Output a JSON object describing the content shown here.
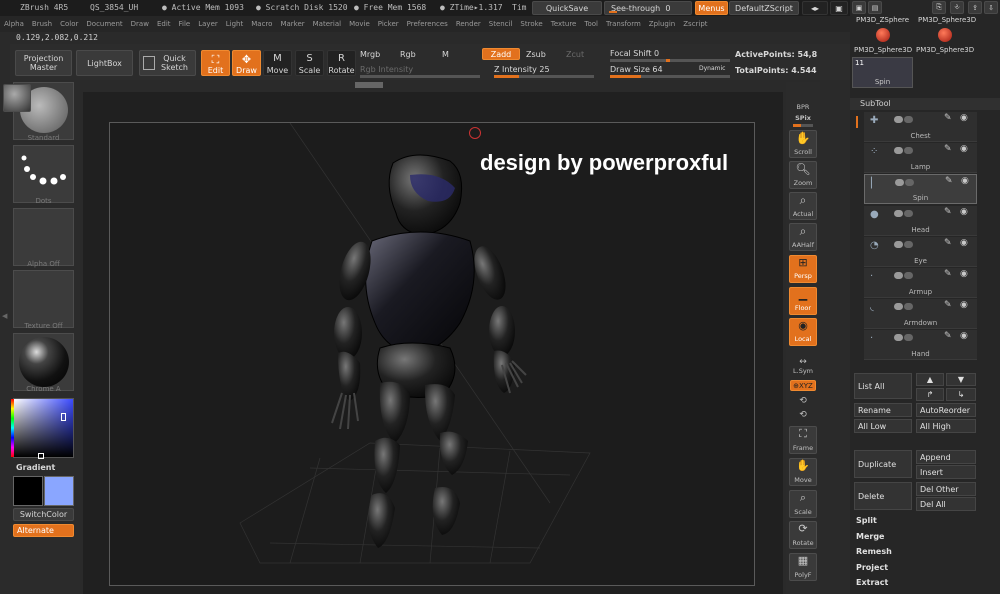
{
  "topbar": {
    "app": "ZBrush 4R5",
    "build": "QS_3854_UH",
    "active_mem": "● Active Mem 1093",
    "scratch": "● Scratch Disk 1520",
    "free_mem": "● Free Mem 1568",
    "ztime": "● ZTime▸1.317",
    "tim": "Tim",
    "quicksave": "QuickSave",
    "see_through": "See-through",
    "see_through_value": "0",
    "menus": "Menus",
    "default_zscript": "DefaultZScript"
  },
  "menubar": [
    "Alpha",
    "Brush",
    "Color",
    "Document",
    "Draw",
    "Edit",
    "File",
    "Layer",
    "Light",
    "Macro",
    "Marker",
    "Material",
    "Movie",
    "Picker",
    "Preferences",
    "Render",
    "Stencil",
    "Stroke",
    "Texture",
    "Tool",
    "Transform",
    "Zplugin",
    "Zscript"
  ],
  "coords": "0.129,2.082,0.212",
  "shelf": {
    "projection_master": "Projection Master",
    "lightbox": "LightBox",
    "quick_sketch": "Quick Sketch",
    "edit": "Edit",
    "draw": "Draw",
    "move": "Move",
    "scale": "Scale",
    "rotate": "Rotate",
    "mrgb": "Mrgb",
    "rgb": "Rgb",
    "m": "M",
    "zadd": "Zadd",
    "zsub": "Zsub",
    "zcut": "Zcut",
    "rgb_intensity": "Rgb Intensity",
    "z_intensity": "Z Intensity",
    "z_intensity_value": "25",
    "focal_shift": "Focal Shift",
    "focal_shift_value": "0",
    "draw_size": "Draw Size",
    "draw_size_value": "64",
    "dynamic": "Dynamic",
    "active_points": "ActivePoints: 54,8",
    "total_points": "TotalPoints: 4.544"
  },
  "left": {
    "standard": "Standard",
    "dots": "Dots",
    "alpha_off": "Alpha Off",
    "texture_off": "Texture Off",
    "chrome": "Chrome A",
    "gradient": "Gradient",
    "switchcolor": "SwitchColor",
    "alternate": "Alternate",
    "main_color": "#000000",
    "secondary_color": "#8aa6ff"
  },
  "right": {
    "bpr": "BPR",
    "spix": "SPix",
    "scroll": "Scroll",
    "zoom": "Zoom",
    "actual": "Actual",
    "aahalf": "AAHalf",
    "persp": "Persp",
    "floor": "Floor",
    "local": "Local",
    "lsym": "L.Sym",
    "xyz": "⊕XYZ",
    "frame": "Frame",
    "move": "Move",
    "scale": "Scale",
    "rotate": "Rotate",
    "polyf": "PolyF"
  },
  "tray": {
    "tool1": "PM3D_ZSphere",
    "tool2": "PM3D_Sphere3D",
    "tool3": "PM3D_Sphere3D",
    "tool4": "PM3D_Sphere3D",
    "count": "11",
    "spin": "Spin",
    "subtool": "SubTool",
    "subtools": [
      "Chest",
      "Lamp",
      "Spin",
      "Head",
      "Eye",
      "Armup",
      "Armdown",
      "Hand"
    ],
    "list_all": "List All",
    "rename": "Rename",
    "autoreorder": "AutoReorder",
    "all_low": "All Low",
    "all_high": "All High",
    "duplicate": "Duplicate",
    "append": "Append",
    "insert": "Insert",
    "delete": "Delete",
    "del_other": "Del Other",
    "del_all": "Del All",
    "split": "Split",
    "merge": "Merge",
    "remesh": "Remesh",
    "project": "Project",
    "extract": "Extract"
  },
  "watermark": "design by powerproxful"
}
